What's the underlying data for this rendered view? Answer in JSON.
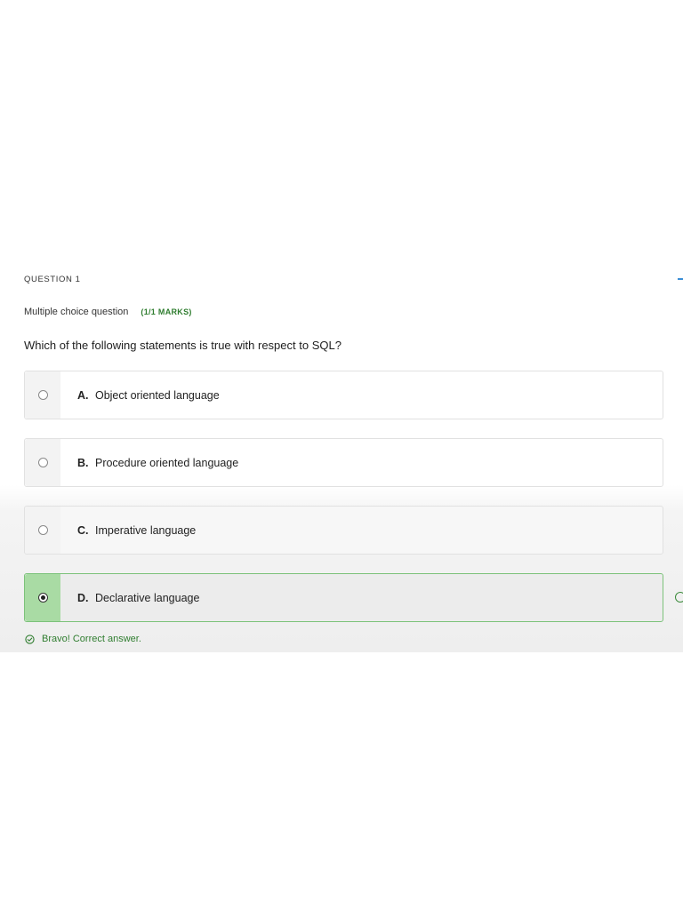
{
  "question": {
    "number_label": "QUESTION 1",
    "type_label": "Multiple choice question",
    "marks_label": "(1/1 MARKS)",
    "text": "Which of the following statements is true with respect to SQL?"
  },
  "options": [
    {
      "letter": "A.",
      "text": "Object oriented language",
      "selected": false
    },
    {
      "letter": "B.",
      "text": "Procedure oriented language",
      "selected": false
    },
    {
      "letter": "C.",
      "text": "Imperative language",
      "selected": false
    },
    {
      "letter": "D.",
      "text": "Declarative language",
      "selected": true
    }
  ],
  "feedback": {
    "icon": "check-circle-icon",
    "text": "Bravo! Correct answer."
  },
  "colors": {
    "accent_green": "#2f7d2f",
    "selected_border": "#7cc27a",
    "selected_radio_bg": "#a9dba4"
  }
}
